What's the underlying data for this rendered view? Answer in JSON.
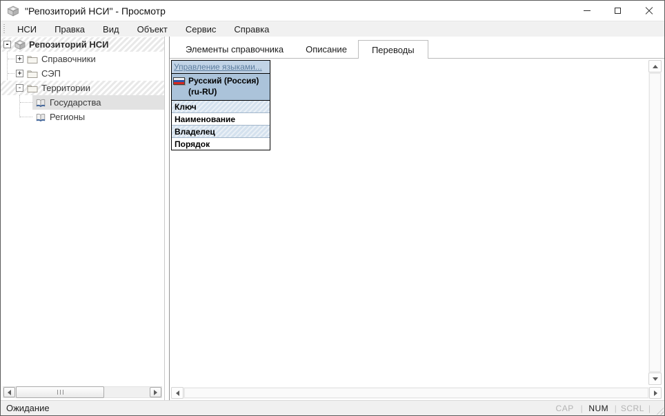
{
  "window": {
    "title": "\"Репозиторий НСИ\" - Просмотр"
  },
  "icons": {
    "app-icon": "3d-package-box",
    "minimize-icon": "─",
    "maximize-icon": "□",
    "close-icon": "✕",
    "folder-icon": "closed-folder",
    "book-icon": "open-book",
    "flag-icon": "russia-flag"
  },
  "menu": {
    "items": [
      "НСИ",
      "Правка",
      "Вид",
      "Объект",
      "Сервис",
      "Справка"
    ]
  },
  "tree": {
    "items": [
      {
        "label": "Репозиторий НСИ",
        "level": 0,
        "icon": "repository-icon",
        "expander": "-",
        "state": "expanded-hatched"
      },
      {
        "label": "Справочники",
        "level": 1,
        "icon": "folder-icon",
        "expander": "+",
        "state": "collapsed"
      },
      {
        "label": "СЭП",
        "level": 1,
        "icon": "folder-icon",
        "expander": "+",
        "state": "collapsed"
      },
      {
        "label": "Территории",
        "level": 1,
        "icon": "folder-icon",
        "expander": "-",
        "state": "expanded-hatched"
      },
      {
        "label": "Государства",
        "level": 2,
        "icon": "book-icon",
        "expander": "",
        "state": "selected"
      },
      {
        "label": "Регионы",
        "level": 2,
        "icon": "book-icon",
        "expander": "",
        "state": "normal"
      }
    ]
  },
  "tabs": [
    {
      "label": "Элементы справочника",
      "active": false
    },
    {
      "label": "Описание",
      "active": false
    },
    {
      "label": "Переводы",
      "active": true
    }
  ],
  "translations_panel": {
    "manage_languages_link": "Управление языками...",
    "language_name": "Русский (Россия)",
    "language_code": "(ru-RU)",
    "field_rows": [
      "Ключ",
      "Наименование",
      "Владелец",
      "Порядок"
    ]
  },
  "status_bar": {
    "message": "Ожидание",
    "separator": "|",
    "keys": [
      {
        "label": "CAP",
        "active": false
      },
      {
        "label": "NUM",
        "active": true
      },
      {
        "label": "SCRL",
        "active": false
      }
    ]
  },
  "colors": {
    "table_header_bg": "#c1d3e6",
    "table_link_text": "#5b7c9e",
    "table_language_bg": "#abc3da",
    "table_alt_row_bg": "#d4e1ee",
    "tree_selection_bg": "#e2e2e2",
    "tree_hatch_stripe": "#e9e9e9",
    "flag_white": "#f5f5f5",
    "flag_blue": "#2d50a7",
    "flag_red": "#d6281e"
  }
}
